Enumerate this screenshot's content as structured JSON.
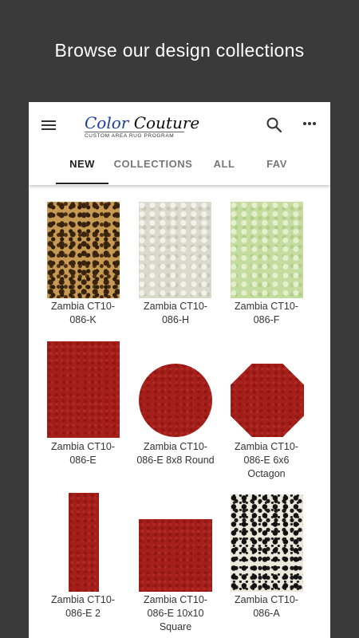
{
  "promo": {
    "headline": "Browse our design collections"
  },
  "app": {
    "logo": {
      "title_part1": "Color",
      "title_part2": "Couture",
      "subtitle": "CUSTOM AREA RUG PROGRAM"
    },
    "tabs": [
      {
        "label": "NEW",
        "active": true
      },
      {
        "label": "COLLECTIONS",
        "active": false
      },
      {
        "label": "ALL",
        "active": false
      },
      {
        "label": "FAV",
        "active": false
      }
    ]
  },
  "products": [
    {
      "label": "Zambia CT10-086-K",
      "line1": "Zambia CT10-",
      "line2": "086-K",
      "line3": "",
      "shape": "rectangle",
      "pattern": "leopard-tan"
    },
    {
      "label": "Zambia CT10-086-H",
      "line1": "Zambia CT10-",
      "line2": "086-H",
      "line3": "",
      "shape": "rectangle",
      "pattern": "leopard-ivory"
    },
    {
      "label": "Zambia CT10-086-F",
      "line1": "Zambia CT10-",
      "line2": "086-F",
      "line3": "",
      "shape": "rectangle",
      "pattern": "leopard-green"
    },
    {
      "label": "Zambia CT10-086-E",
      "line1": "Zambia CT10-",
      "line2": "086-E",
      "line3": "",
      "shape": "rectangle",
      "pattern": "red"
    },
    {
      "label": "Zambia CT10-086-E 8x8 Round",
      "line1": "Zambia CT10-",
      "line2": "086-E 8x8 Round",
      "line3": "",
      "shape": "round",
      "pattern": "red"
    },
    {
      "label": "Zambia CT10-086-E 6x6 Octagon",
      "line1": "Zambia CT10-",
      "line2": "086-E 6x6",
      "line3": "Octagon",
      "shape": "octagon",
      "pattern": "red"
    },
    {
      "label": "Zambia CT10-086-E 2",
      "line1": "Zambia CT10-",
      "line2": "086-E 2",
      "line3": "",
      "shape": "runner",
      "pattern": "red"
    },
    {
      "label": "Zambia CT10-086-E 10x10 Square",
      "line1": "Zambia CT10-",
      "line2": "086-E 10x10",
      "line3": "Square",
      "shape": "square",
      "pattern": "red"
    },
    {
      "label": "Zambia CT10-086-A",
      "line1": "Zambia CT10-",
      "line2": "086-A",
      "line3": "",
      "shape": "rectangle",
      "pattern": "leopard-black-white"
    }
  ],
  "icons": {
    "menu": "hamburger-menu-icon",
    "search": "search-icon",
    "more": "more-vertical-dots-icon"
  },
  "colors": {
    "background": "#3a3a3a",
    "app_surface": "#ffffff",
    "rug_red": "#a51f1a",
    "logo_blue": "#1a3f9a",
    "logo_red": "#c0392b"
  }
}
